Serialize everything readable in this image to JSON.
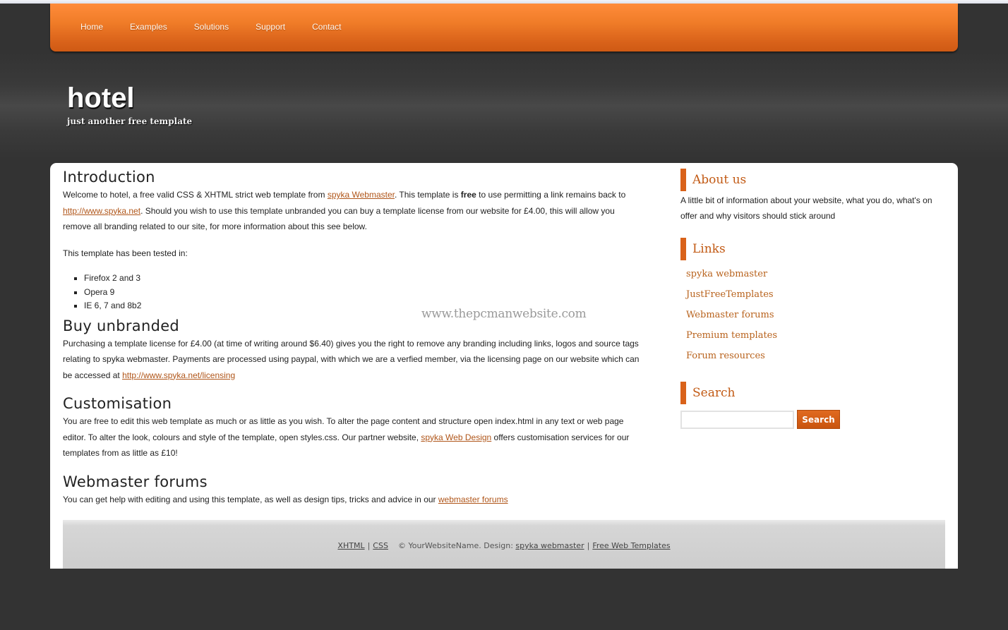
{
  "nav": {
    "items": [
      {
        "label": "Home"
      },
      {
        "label": "Examples"
      },
      {
        "label": "Solutions"
      },
      {
        "label": "Support"
      },
      {
        "label": "Contact"
      }
    ]
  },
  "header": {
    "title": "hotel",
    "slogan": "just another free template"
  },
  "watermark": "www.thepcmanwebsite.com",
  "main": {
    "intro": {
      "heading": "Introduction",
      "p1_a": "Welcome to hotel, a free valid CSS & XHTML strict web template from ",
      "p1_link1": "spyka Webmaster",
      "p1_b": ". This template is ",
      "p1_bold": "free",
      "p1_c": " to use permitting a link remains back to ",
      "p1_link2": "http://www.spyka.net",
      "p1_d": ". Should you wish to use this template unbranded you can buy a template license from our website for £4.00, this will allow you remove all branding related to our site, for more information about this see below.",
      "p2": "This template has been tested in:",
      "tested": [
        "Firefox 2 and 3",
        "Opera 9",
        "IE 6, 7 and 8b2"
      ]
    },
    "buy": {
      "heading": "Buy unbranded",
      "text": "Purchasing a template license for £4.00 (at time of writing around $6.40) gives you the right to remove any branding including links, logos and source tags relating to spyka webmaster. Payments are processed using paypal, with which we are a verfied member, via the licensing page on our website which can be accessed at ",
      "link": "http://www.spyka.net/licensing"
    },
    "custom": {
      "heading": "Customisation",
      "text_a": "You are free to edit this web template as much or as little as you wish. To alter the page content and structure open index.html in any text or web page editor. To alter the look, colours and style of the template, open styles.css. Our partner website, ",
      "link": "spyka Web Design",
      "text_b": " offers customisation services for our templates from as little as £10!"
    },
    "forums": {
      "heading": "Webmaster forums",
      "text": "You can get help with editing and using this template, as well as design tips, tricks and advice in our ",
      "link": "webmaster forums"
    }
  },
  "sidebar": {
    "about": {
      "heading": "About us",
      "text": "A little bit of information about your website, what you do, what's on offer and why visitors should stick around"
    },
    "links": {
      "heading": "Links",
      "items": [
        {
          "label": "spyka webmaster"
        },
        {
          "label": "JustFreeTemplates"
        },
        {
          "label": "Webmaster forums"
        },
        {
          "label": "Premium templates"
        },
        {
          "label": "Forum resources"
        }
      ]
    },
    "search": {
      "heading": "Search",
      "value": "",
      "placeholder": "",
      "button": "Search"
    }
  },
  "footer": {
    "xhtml": "XHTML",
    "sep": "|",
    "css": "CSS",
    "copyright": "© YourWebsiteName. Design: ",
    "design_link": "spyka webmaster",
    "templates_link": "Free Web Templates"
  },
  "colors": {
    "accent": "#d9621a",
    "link": "#b0561a",
    "background": "#333333"
  }
}
